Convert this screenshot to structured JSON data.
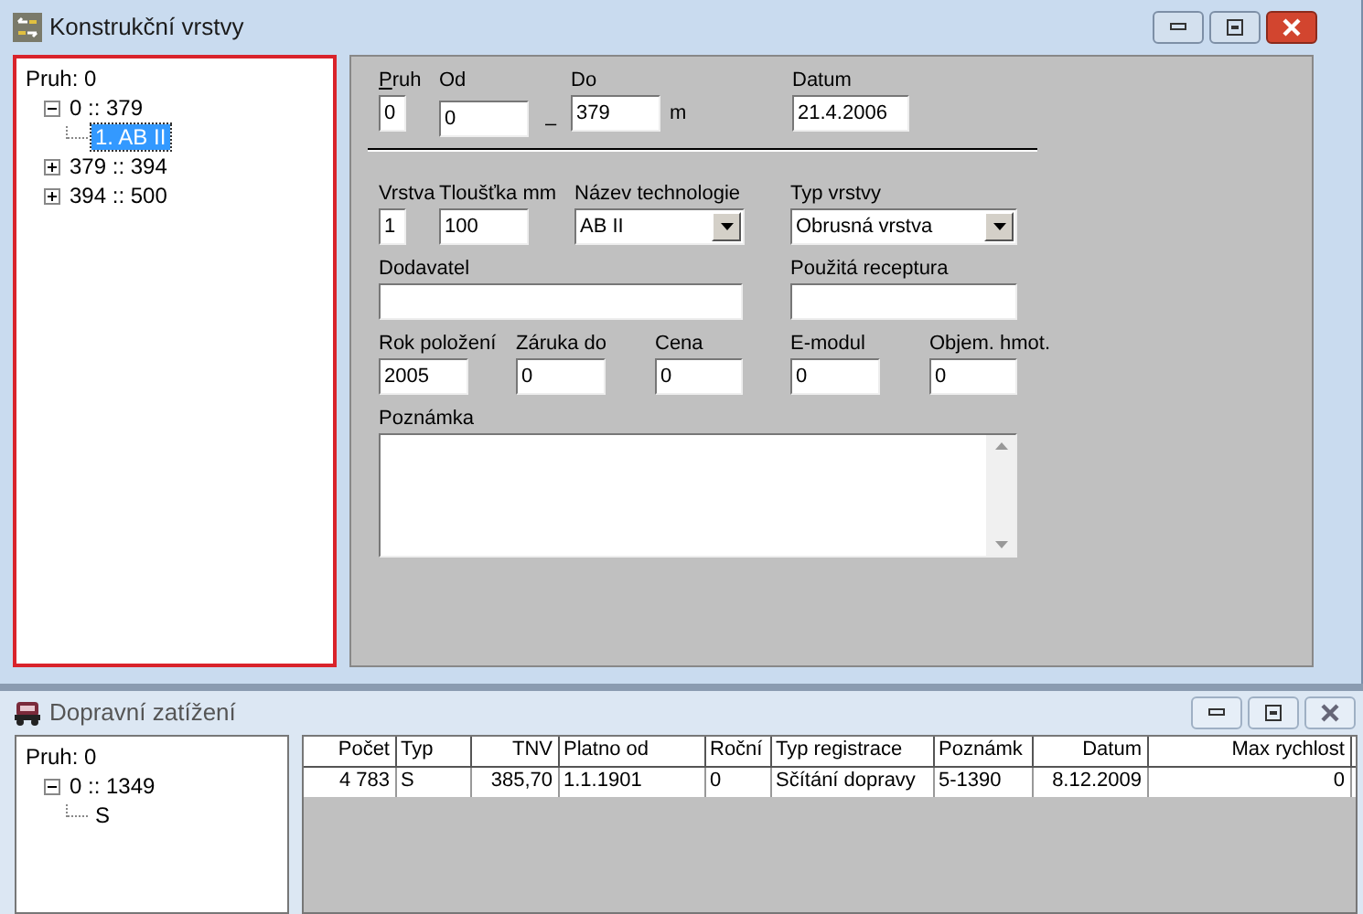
{
  "top_window": {
    "title": "Konstrukční vrstvy",
    "tree": [
      {
        "label": "Pruh: 0",
        "selected": false,
        "children": [
          {
            "label": "0 :: 379",
            "expanded": true,
            "selected": false,
            "children": [
              {
                "label": "1. AB II",
                "selected": true
              }
            ]
          },
          {
            "label": "379 :: 394",
            "expanded": false,
            "selected": false
          },
          {
            "label": "394 :: 500",
            "expanded": false,
            "selected": false
          }
        ]
      }
    ],
    "form": {
      "fields": [
        {
          "kind": "text",
          "label": "Pruh",
          "access_key": true,
          "value": "0"
        },
        {
          "kind": "text",
          "label": "Od",
          "value": "0",
          "suffix": "–"
        },
        {
          "kind": "text",
          "label": "Do",
          "value": "379",
          "unit": "m"
        },
        {
          "kind": "text",
          "label": "Datum",
          "value": "21.4.2006"
        },
        {
          "kind": "text",
          "label": "Vrstva",
          "value": "1"
        },
        {
          "kind": "text",
          "label": "Tloušťka mm",
          "value": "100"
        },
        {
          "kind": "select",
          "label": "Název technologie",
          "value": "AB II"
        },
        {
          "kind": "select",
          "label": "Typ vrstvy",
          "value": "Obrusná vrstva"
        },
        {
          "kind": "text",
          "label": "Dodavatel"
        },
        {
          "kind": "text",
          "label": "Použitá receptura"
        },
        {
          "kind": "text",
          "label": "Rok položení",
          "value": "2005"
        },
        {
          "kind": "text",
          "label": "Záruka do",
          "value": "0"
        },
        {
          "kind": "text",
          "label": "Cena",
          "value": "0"
        },
        {
          "kind": "text",
          "label": "E-modul",
          "value": "0"
        },
        {
          "kind": "text",
          "label": "Objem. hmot.",
          "value": "0"
        },
        {
          "kind": "textarea",
          "label": "Poznámka"
        }
      ]
    }
  },
  "bottom_window": {
    "title": "Dopravní zatížení",
    "tree": [
      {
        "label": "Pruh: 0",
        "selected": false,
        "children": [
          {
            "label": "0 :: 1349",
            "expanded": true,
            "selected": false,
            "children": [
              {
                "label": "S",
                "selected": false
              }
            ]
          }
        ]
      }
    ],
    "table": {
      "columns": [
        "Počet",
        "Typ",
        "TNV",
        "Platno od",
        "Roční",
        "Typ registrace",
        "Poznámk",
        "Datum",
        "Max rychlost"
      ],
      "rows": [
        [
          "4 783",
          "S",
          "385,70",
          "1.1.1901",
          "0",
          "Sčítání dopravy",
          "5-1390",
          "8.12.2009",
          "0"
        ]
      ]
    }
  }
}
